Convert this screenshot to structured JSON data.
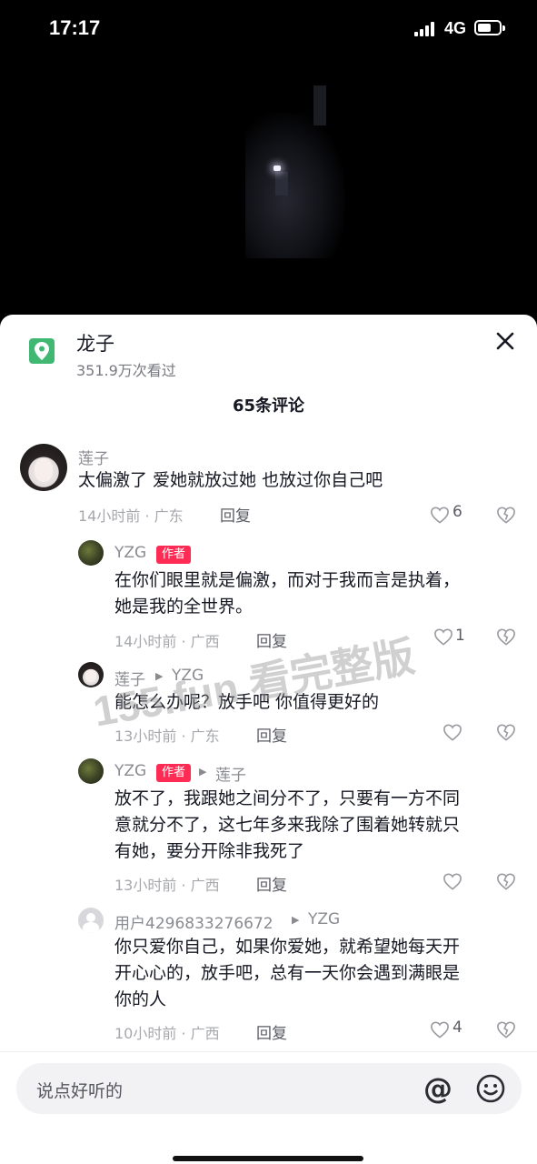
{
  "status_bar": {
    "time": "17:17",
    "network": "4G",
    "battery_level": 0.65
  },
  "location": {
    "title": "龙子",
    "views": "351.9万次看过"
  },
  "comments_header": {
    "count_label": "65条评论"
  },
  "watermark": "155.fun 看完整版",
  "comments": [
    {
      "author": "莲子",
      "text": "太偏激了 爱她就放过她 也放过你自己吧",
      "meta": "14小时前 · 广东",
      "reply_label": "回复",
      "likes": "6"
    },
    {
      "author": "YZG",
      "author_tag": "作者",
      "text_lines": [
        "在你们眼里就是偏激，而对于我而言是执着，",
        "她是我的全世界。"
      ],
      "meta": "14小时前 · 广西",
      "reply_label": "回复",
      "likes": "1"
    },
    {
      "author": "莲子",
      "reply_to": "YZG",
      "text": "能怎么办呢？放手吧 你值得更好的",
      "meta": "13小时前 · 广东",
      "reply_label": "回复",
      "likes": ""
    },
    {
      "author": "YZG",
      "author_tag": "作者",
      "reply_to": "莲子",
      "text_lines": [
        "放不了，我跟她之间分不了，只要有一方不同",
        "意就分不了，这七年多来我除了围着她转就只",
        "有她，要分开除非我死了"
      ],
      "meta": "13小时前 · 广西",
      "reply_label": "回复",
      "likes": ""
    },
    {
      "author": "用户4296833276672",
      "reply_to": "YZG",
      "text_lines": [
        "你只爱你自己，如果你爱她，就希望她每天开",
        "开心心的，放手吧，总有一天你会遇到满眼是",
        "你的人"
      ],
      "meta": "10小时前 · 广西",
      "reply_label": "回复",
      "likes": "4"
    }
  ],
  "input": {
    "placeholder": "说点好听的",
    "at_symbol": "@"
  },
  "colors": {
    "accent": "#fe2c55",
    "location_icon_bg": "#41b872"
  },
  "icons": [
    "location-pin-icon",
    "close-icon",
    "heart-icon",
    "broken-heart-icon",
    "at-icon",
    "emoji-icon"
  ]
}
